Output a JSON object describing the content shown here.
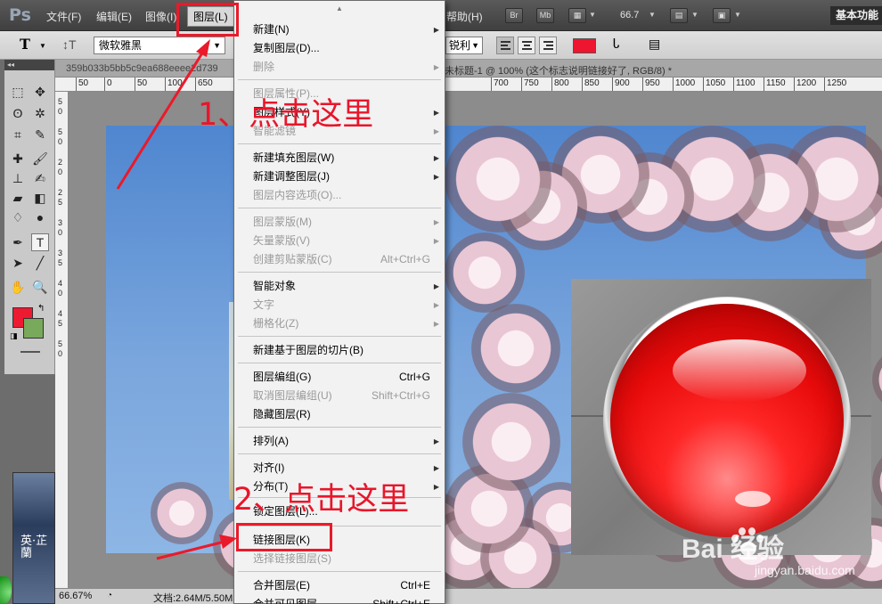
{
  "menubar": {
    "logo": "Ps",
    "items": [
      {
        "label": "文件(F)"
      },
      {
        "label": "编辑(E)"
      },
      {
        "label": "图像(I)"
      },
      {
        "label": "图层(L)"
      }
    ],
    "help_label": "帮助(H)",
    "mode_buttons": [
      "Br",
      "Mb"
    ],
    "zoom": "66.7",
    "workspace": "基本功能"
  },
  "options_bar": {
    "tool_glyph": "T",
    "font_family": "微软雅黑",
    "antialias": "锐利",
    "text_color": "#ee1530"
  },
  "document": {
    "tab_left": "359b033b5bb5c9ea688eeee2d739",
    "tab_right": "未标题-1 @ 100% (这个标志说明链接好了, RGB/8) *",
    "ruler_labels": [
      "50",
      "0",
      "50",
      "100",
      "650",
      "700",
      "750",
      "800",
      "850",
      "900",
      "950",
      "1000",
      "1050",
      "1100",
      "1150",
      "1200",
      "1250"
    ],
    "vruler_labels": [
      "5",
      "0",
      "5",
      "0",
      "2",
      "0",
      "2",
      "5",
      "3",
      "0",
      "3",
      "5",
      "4",
      "0",
      "4",
      "5",
      "5",
      "0"
    ]
  },
  "status": {
    "zoom": "66.67%",
    "doc_info": "文档:2.64M/5.50M"
  },
  "decoration": {
    "text": "英·芷蘭"
  },
  "layer_menu": {
    "items": [
      {
        "label": "新建(N)",
        "shortcut": "",
        "disabled": false,
        "submenu": true
      },
      {
        "label": "复制图层(D)...",
        "shortcut": "",
        "disabled": false,
        "submenu": false
      },
      {
        "label": "删除",
        "shortcut": "",
        "disabled": true,
        "submenu": true
      },
      {
        "label": "图层属性(P)...",
        "shortcut": "",
        "disabled": true,
        "submenu": false
      },
      {
        "label": "图层样式(Y)",
        "shortcut": "",
        "disabled": false,
        "submenu": true
      },
      {
        "label": "智能滤镜",
        "shortcut": "",
        "disabled": true,
        "submenu": true
      },
      {
        "label": "新建填充图层(W)",
        "shortcut": "",
        "disabled": false,
        "submenu": true
      },
      {
        "label": "新建调整图层(J)",
        "shortcut": "",
        "disabled": false,
        "submenu": true
      },
      {
        "label": "图层内容选项(O)...",
        "shortcut": "",
        "disabled": true,
        "submenu": false
      },
      {
        "label": "图层蒙版(M)",
        "shortcut": "",
        "disabled": true,
        "submenu": true
      },
      {
        "label": "矢量蒙版(V)",
        "shortcut": "",
        "disabled": true,
        "submenu": true
      },
      {
        "label": "创建剪贴蒙版(C)",
        "shortcut": "Alt+Ctrl+G",
        "disabled": true,
        "submenu": false
      },
      {
        "label": "智能对象",
        "shortcut": "",
        "disabled": false,
        "submenu": true
      },
      {
        "label": "文字",
        "shortcut": "",
        "disabled": true,
        "submenu": true
      },
      {
        "label": "栅格化(Z)",
        "shortcut": "",
        "disabled": true,
        "submenu": true
      },
      {
        "label": "新建基于图层的切片(B)",
        "shortcut": "",
        "disabled": false,
        "submenu": false
      },
      {
        "label": "图层编组(G)",
        "shortcut": "Ctrl+G",
        "disabled": false,
        "submenu": false
      },
      {
        "label": "取消图层编组(U)",
        "shortcut": "Shift+Ctrl+G",
        "disabled": true,
        "submenu": false
      },
      {
        "label": "隐藏图层(R)",
        "shortcut": "",
        "disabled": false,
        "submenu": false
      },
      {
        "label": "排列(A)",
        "shortcut": "",
        "disabled": false,
        "submenu": true
      },
      {
        "label": "对齐(I)",
        "shortcut": "",
        "disabled": false,
        "submenu": true
      },
      {
        "label": "分布(T)",
        "shortcut": "",
        "disabled": false,
        "submenu": true
      },
      {
        "label": "锁定图层(L)...",
        "shortcut": "",
        "disabled": false,
        "submenu": false
      },
      {
        "label": "链接图层(K)",
        "shortcut": "",
        "disabled": false,
        "submenu": false
      },
      {
        "label": "选择链接图层(S)",
        "shortcut": "",
        "disabled": true,
        "submenu": false
      },
      {
        "label": "合并图层(E)",
        "shortcut": "Ctrl+E",
        "disabled": false,
        "submenu": false
      },
      {
        "label": "合并可见图层",
        "shortcut": "Shift+Ctrl+E",
        "disabled": false,
        "submenu": false
      }
    ]
  },
  "annotations": {
    "step1": "1、点击这里",
    "step2": "2、点击这里",
    "color": "#ea1a2a"
  },
  "watermark": {
    "brand": "Bai  经验",
    "url": "jingyan.baidu.com"
  }
}
